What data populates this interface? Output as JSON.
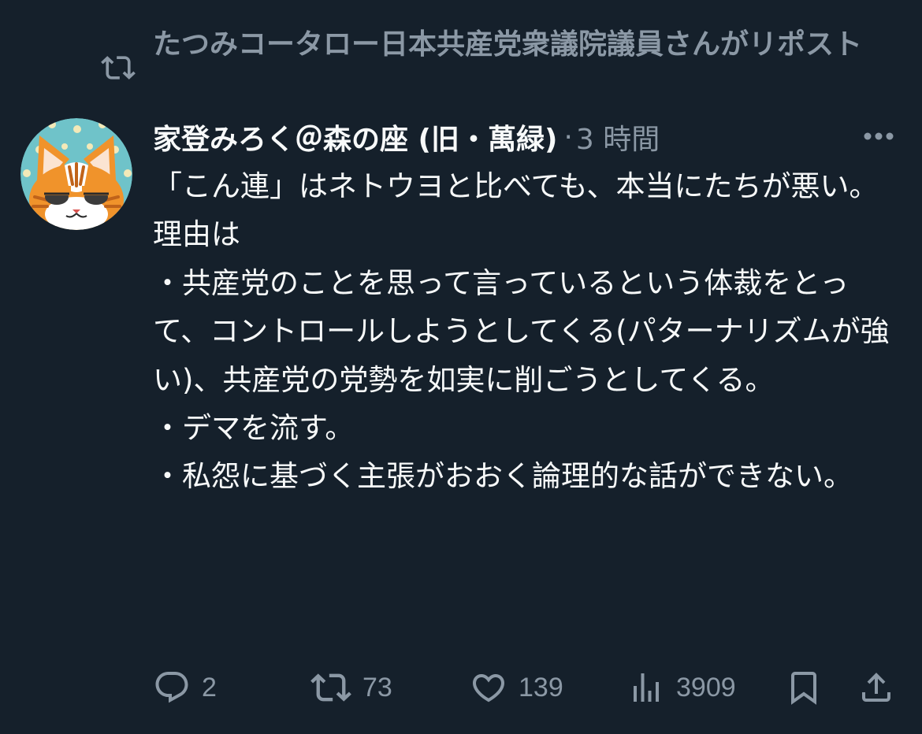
{
  "repost": {
    "icon": "repost-icon",
    "text": "たつみコータロー日本共産党衆議院議員さんがリポスト"
  },
  "post": {
    "avatar": "cat-avatar",
    "author_name": "家登みろく＠森の座 (旧・萬緑)",
    "separator": "·",
    "time": "3 時間",
    "more_icon": "more-icon",
    "lines": [
      "「こん連」はネトウヨと比べても、本当にたちが悪い。",
      "理由は",
      "・共産党のことを思って言っているという体裁をとって、コントロールしようとしてくる(パターナリズムが強い)、共産党の党勢を如実に削ごうとしてくる。",
      "・デマを流す。",
      "・私怨に基づく主張がおおく論理的な話ができない。"
    ]
  },
  "actions": {
    "reply": {
      "icon": "reply-icon",
      "count": "2"
    },
    "repost": {
      "icon": "repost-icon",
      "count": "73"
    },
    "like": {
      "icon": "heart-icon",
      "count": "139"
    },
    "views": {
      "icon": "views-icon",
      "count": "3909"
    },
    "bookmark": {
      "icon": "bookmark-icon"
    },
    "share": {
      "icon": "share-icon"
    }
  },
  "colors": {
    "background": "#15202b",
    "text_primary": "#f7f9f9",
    "text_secondary": "#8b98a5"
  }
}
